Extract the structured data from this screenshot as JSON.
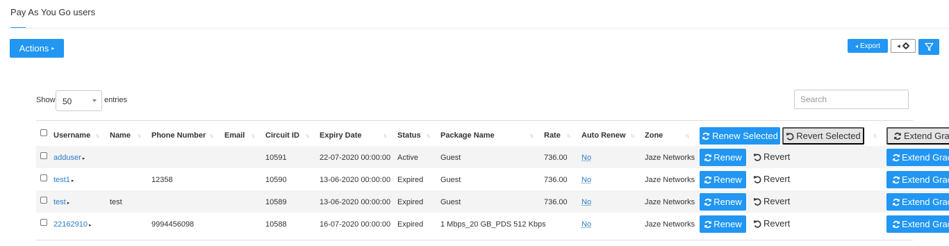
{
  "page": {
    "title": "Pay As You Go users"
  },
  "toolbar": {
    "actions_label": "Actions",
    "export_label": "Export"
  },
  "table_controls": {
    "show_label": "Show",
    "page_size": "50",
    "entries_label": "entries",
    "search_placeholder": "Search"
  },
  "columns": [
    "Username",
    "Name",
    "Phone Number",
    "Email",
    "Circuit ID",
    "Expiry Date",
    "Status",
    "Package Name",
    "Rate",
    "Auto Renew",
    "Zone"
  ],
  "header_actions": {
    "renew_selected": "Renew Selected",
    "revert_selected": "Revert Selected",
    "extend_grace": "Extend Grac"
  },
  "row_actions": {
    "renew": "Renew",
    "revert": "Revert",
    "extend_grace": "Extend Grac"
  },
  "rows": [
    {
      "username": "adduser",
      "name": "",
      "phone": "",
      "email": "",
      "circuit_id": "10591",
      "expiry": "22-07-2020 00:00:00",
      "status": "Active",
      "package": "Guest",
      "rate": "736.00",
      "auto_renew": "No",
      "zone": "Jaze Networks"
    },
    {
      "username": "test1",
      "name": "",
      "phone": "12358",
      "email": "",
      "circuit_id": "10590",
      "expiry": "13-06-2020 00:00:00",
      "status": "Expired",
      "package": "Guest",
      "rate": "736.00",
      "auto_renew": "No",
      "zone": "Jaze Networks"
    },
    {
      "username": "test",
      "name": "test",
      "phone": "",
      "email": "",
      "circuit_id": "10589",
      "expiry": "13-06-2020 00:00:00",
      "status": "Expired",
      "package": "Guest",
      "rate": "736.00",
      "auto_renew": "No",
      "zone": "Jaze Networks"
    },
    {
      "username": "22162910",
      "name": "",
      "phone": "9994456098",
      "email": "",
      "circuit_id": "10588",
      "expiry": "16-07-2020 00:00:00",
      "status": "Expired",
      "package": "1 Mbps_20 GB_PDS 512 Kbps",
      "rate": "",
      "auto_renew": "No",
      "zone": "Jaze Networks"
    }
  ],
  "colors": {
    "accent": "#2196f3",
    "link": "#2a7dc9",
    "stripe": "#f4f4f4"
  },
  "icons": [
    "caret-right-icon",
    "caret-left-icon",
    "gear-icon",
    "filter-icon",
    "refresh-icon",
    "undo-icon",
    "sort-icon",
    "dropdown-arrow-icon"
  ]
}
